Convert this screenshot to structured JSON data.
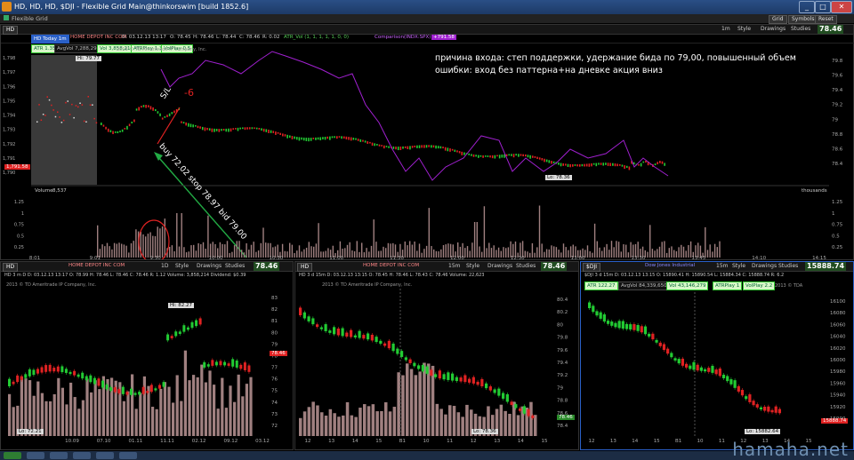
{
  "window": {
    "title": "HD, HD, HD, $DJI - Flexible Grid Main@thinkorswim [build 1852.6]"
  },
  "menu": {
    "tab": "Flexible Grid",
    "buttons": [
      "Grid",
      "Symbols",
      "Reset"
    ]
  },
  "main": {
    "symbol": "HD",
    "company": "HOME DEPOT INC COM",
    "period": "1m",
    "style_label": "Style",
    "drawings_label": "Drawings",
    "studies_label": "Studies",
    "last_price": "78.46",
    "header_info": [
      "D: 03.12.13 13:17",
      "O: 78.45",
      "H: 78.46",
      "L: 78.44",
      "C: 78.46",
      "R: 0.02"
    ],
    "atr_label": "ATR_Vol (1, 1, 1, 1, 1, 0, 0)",
    "compare_label": "Comparison(INDX:SPX)",
    "compare_value": "+791.58",
    "today_badge": "HD Today 1m",
    "badges": [
      "ATR 1.35",
      "AvgVol 7,288,290",
      "Vol 3,858,214",
      "ATRPlay 1.3",
      "VolPlay 0.5"
    ],
    "copyright": "2013 © TD Ameritrade IP Company, Inc.",
    "hi_label": "Hi: 79.77",
    "lo_label": "Lo: 78.36",
    "left_axis": [
      "1,798",
      "1,797",
      "1,796",
      "1,795",
      "1,794",
      "1,793",
      "1,792",
      "1,791",
      "1,790"
    ],
    "left_price_tag": "1,791.58",
    "right_axis": [
      "79.8",
      "79.6",
      "79.4",
      "79.2",
      "79",
      "78.8",
      "78.6",
      "78.4"
    ],
    "volume_label": "Volume",
    "volume_value": "8,537",
    "volume_axis": [
      "1.25",
      "1",
      "0.75",
      "0.5",
      "0.25"
    ],
    "volume_unit": "thousands",
    "time_axis": [
      "8:01",
      "9:01",
      "9:30",
      "10:00",
      "10:30",
      "11:00",
      "11:30",
      "12:00",
      "12:30",
      "13:00",
      "13:30",
      "13:45",
      "14:10",
      "14:15"
    ],
    "annot_sl": "S/L",
    "annot_minus6": "-6",
    "annot_buy": "buy 72.02 stop 78.97 bid 79.00",
    "note_line1": "причина входа: степ поддержки, удержание бида по 79,00, повышенный объем",
    "note_line2": "ошибки: вход без паттерна+на дневке акция вниз"
  },
  "panel1": {
    "symbol": "HD",
    "company": "HOME DEPOT INC COM",
    "period": "1D",
    "style_label": "Style",
    "drawings_label": "Drawings",
    "studies_label": "Studies",
    "last_price": "78.46",
    "header": "HD 3 m D  D: 03.12.13 13:17  O: 78.99  H: 78.46  L: 78.46  C: 78.46  R: 1.12  Volume: 3,858,214  Dividend: $0.39",
    "copyright": "2013 © TD Ameritrade IP Company, Inc.",
    "hi_label": "Hi: 82.27",
    "lo_label": "Lo: 72.21",
    "right_axis": [
      "83",
      "82",
      "81",
      "80",
      "79",
      "78",
      "77",
      "76",
      "75",
      "74",
      "73",
      "72"
    ],
    "price_tag": "78.46",
    "time_axis": [
      "10.09",
      "07.10",
      "01.11",
      "11.11",
      "02.12",
      "09.12",
      "03.12"
    ]
  },
  "panel2": {
    "symbol": "HD",
    "company": "HOME DEPOT INC COM",
    "period": "15m",
    "style_label": "Style",
    "drawings_label": "Drawings",
    "studies_label": "Studies",
    "last_price": "78.46",
    "header": "HD 3 d 15m  D: 03.12.13 13:15  O: 78.45  H: 78.46  L: 78.43  C: 78.46  Volume: 22,623",
    "copyright": "2013 © TD Ameritrade IP Company, Inc.",
    "lo_label": "Lo: 78.36",
    "right_axis": [
      "80.4",
      "80.2",
      "80",
      "79.8",
      "79.6",
      "79.4",
      "79.2",
      "79",
      "78.8",
      "78.6",
      "78.4"
    ],
    "price_tag": "78.46",
    "time_axis": [
      "12",
      "13",
      "14",
      "15",
      "B1",
      "10",
      "11",
      "12",
      "13",
      "14",
      "15"
    ]
  },
  "panel3": {
    "symbol": "$DJI",
    "company": "Dow Jones Industrial",
    "period": "15m",
    "style_label": "Style",
    "drawings_label": "Drawings",
    "studies_label": "Studies",
    "last_price": "15888.74",
    "header": "$DJI 3 d 15m  D: 03.12.13 13:15  O: 15890.41  H: 15890.54  L: 15884.34  C: 15888.74  R: 6.2",
    "badges": [
      "ATR 122.27",
      "AvgVol 84,339,650",
      "Vol 43,146,279",
      "ATRPlay 1",
      "VolPlay 2.2"
    ],
    "copyright": "2013 © TDA",
    "lo_label": "Lo: 15882.64",
    "right_axis": [
      "16100",
      "16080",
      "16060",
      "16040",
      "16020",
      "16000",
      "15980",
      "15960",
      "15940",
      "15920",
      "15900"
    ],
    "price_tag": "15888.74",
    "time_axis": [
      "12",
      "13",
      "14",
      "15",
      "B1",
      "10",
      "11",
      "12",
      "13",
      "14",
      "15"
    ]
  },
  "watermark": "hamaha.net",
  "colors": {
    "up": "#22cc33",
    "down": "#e02222",
    "compare": "#a020d0",
    "volume": "#a08080",
    "panel_accent": "#2a60c8"
  }
}
